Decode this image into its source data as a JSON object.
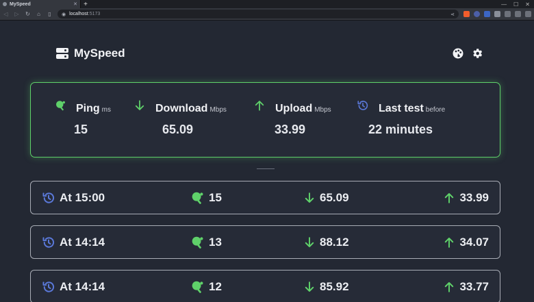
{
  "browser": {
    "tab_title": "MySpeed",
    "new_tab": "+",
    "window_close": "✕",
    "url_host": "localhost",
    "url_port": ":5173"
  },
  "app": {
    "brand": "MySpeed"
  },
  "stats": {
    "ping": {
      "label": "Ping",
      "unit": "ms",
      "value": "15"
    },
    "download": {
      "label": "Download",
      "unit": "Mbps",
      "value": "65.09"
    },
    "upload": {
      "label": "Upload",
      "unit": "Mbps",
      "value": "33.99"
    },
    "last_test": {
      "label": "Last test",
      "unit": "before",
      "value": "22 minutes"
    }
  },
  "history": [
    {
      "time": "At 15:00",
      "ping": "15",
      "download": "65.09",
      "upload": "33.99"
    },
    {
      "time": "At 14:14",
      "ping": "13",
      "download": "88.12",
      "upload": "34.07"
    },
    {
      "time": "At 14:14",
      "ping": "12",
      "download": "85.92",
      "upload": "33.77"
    }
  ],
  "colors": {
    "background": "#232833",
    "accent_green": "#5fd16a",
    "history_blue": "#5a78d8",
    "card_border": "#a9adb6"
  },
  "icons": {
    "ping": "ping-pong-icon",
    "download": "arrow-down-icon",
    "upload": "arrow-up-icon",
    "last_test": "history-clock-icon",
    "theme": "palette-icon",
    "settings": "gear-icon"
  }
}
